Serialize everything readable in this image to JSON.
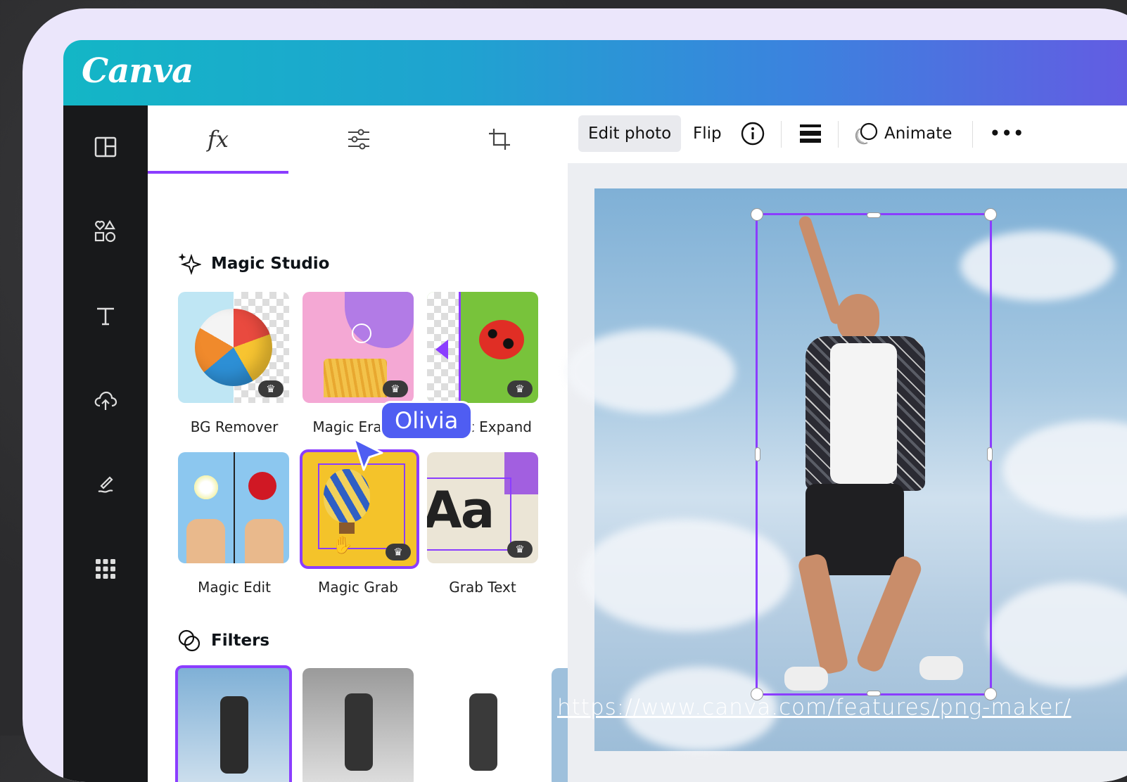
{
  "app": {
    "logo": "Canva"
  },
  "panel": {
    "tabs": [
      {
        "label": "fx",
        "icon": "effects-icon"
      },
      {
        "icon": "adjust-sliders-icon"
      },
      {
        "icon": "crop-icon"
      }
    ],
    "magic_studio": {
      "title": "Magic Studio",
      "items": [
        {
          "label": "BG Remover"
        },
        {
          "label": "Magic Eraser"
        },
        {
          "label": "Magic Expand"
        },
        {
          "label": "Magic Edit"
        },
        {
          "label": "Magic Grab"
        },
        {
          "label": "Grab Text"
        }
      ]
    },
    "filters": {
      "title": "Filters"
    }
  },
  "toolbar": {
    "edit_photo": "Edit photo",
    "flip": "Flip",
    "animate": "Animate",
    "more": "•••"
  },
  "collaborator": {
    "name": "Olivia"
  },
  "tile_text": {
    "aa": "Aa"
  },
  "source_url": "https://www.canva.com/features/png-maker/",
  "colors": {
    "accent": "#8b3dff",
    "collab": "#4f5df2",
    "rail": "#18191b"
  }
}
